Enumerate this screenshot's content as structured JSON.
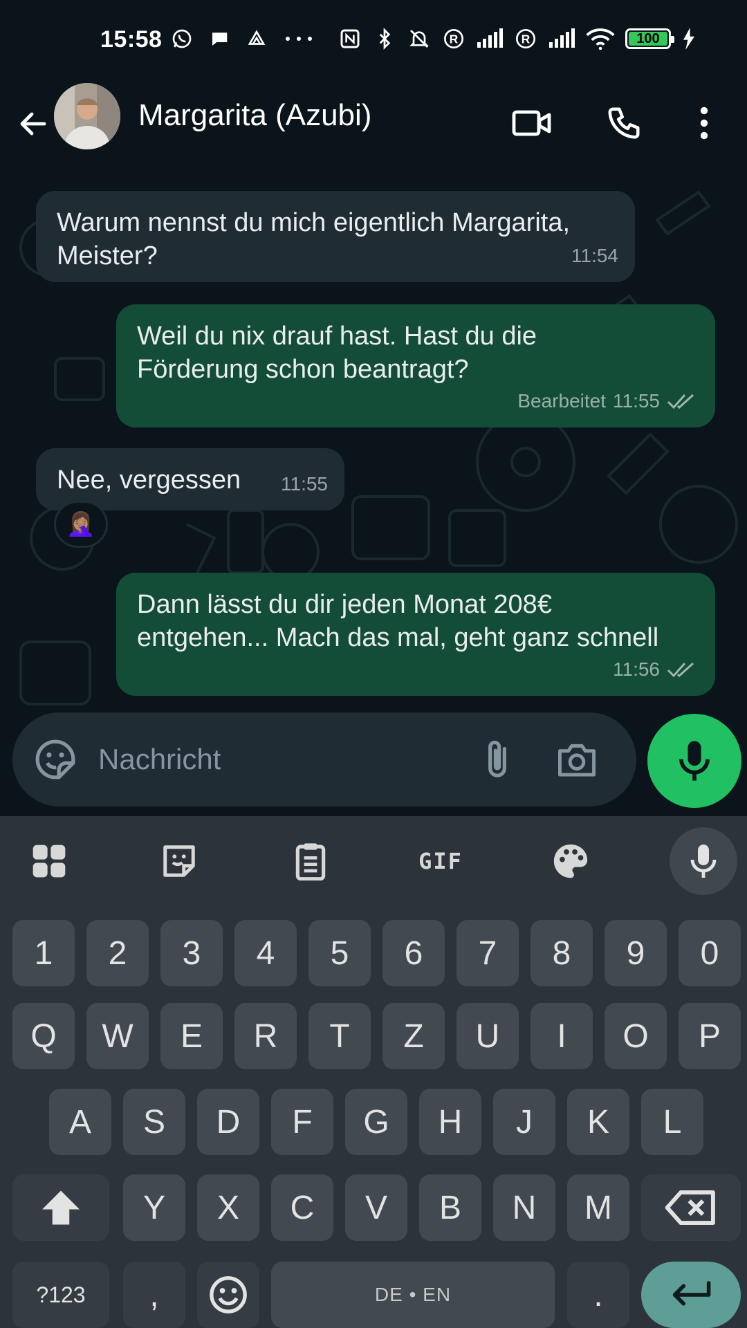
{
  "status_bar": {
    "time": "15:58",
    "battery_level": "100",
    "icons_left": [
      "whatsapp-icon",
      "chat-bubble-icon",
      "drive-icon",
      "more-dots-icon"
    ],
    "icons_right": [
      "nfc-icon",
      "bluetooth-icon",
      "bell-off-icon",
      "registered-icon",
      "signal-icon",
      "registered-icon",
      "signal-icon",
      "wifi-icon",
      "battery-icon",
      "charging-bolt-icon"
    ]
  },
  "header": {
    "contact_name": "Margarita (Azubi)",
    "icons": [
      "back-arrow-icon",
      "video-call-icon",
      "phone-call-icon",
      "more-vert-icon"
    ]
  },
  "messages": [
    {
      "direction": "incoming",
      "text": "Warum nennst du mich eigentlich Margarita,\nMeister?",
      "time": "11:54"
    },
    {
      "direction": "outgoing",
      "text": "Weil du nix drauf hast. Hast du die\nFörderung schon beantragt?",
      "edited_label": "Bearbeitet",
      "time": "11:55",
      "status": "read"
    },
    {
      "direction": "incoming",
      "text": "Nee, vergessen",
      "time": "11:55",
      "reaction": "🤦🏽‍♀️"
    },
    {
      "direction": "outgoing",
      "text": "Dann lässt du dir jeden Monat 208€\nentgehen...  Mach das mal, geht ganz schnell",
      "time": "11:56",
      "status": "read"
    }
  ],
  "composer": {
    "placeholder": "Nachricht"
  },
  "keyboard": {
    "toolbar": [
      "apps-grid-icon",
      "sticker-icon",
      "clipboard-icon",
      "GIF",
      "palette-icon",
      "mic-icon"
    ],
    "gif_label": "GIF",
    "row_numbers": [
      "1",
      "2",
      "3",
      "4",
      "5",
      "6",
      "7",
      "8",
      "9",
      "0"
    ],
    "row_1": [
      "Q",
      "W",
      "E",
      "R",
      "T",
      "Z",
      "U",
      "I",
      "O",
      "P"
    ],
    "row_2": [
      "A",
      "S",
      "D",
      "F",
      "G",
      "H",
      "J",
      "K",
      "L"
    ],
    "row_3": [
      "Y",
      "X",
      "C",
      "V",
      "B",
      "N",
      "M"
    ],
    "symbols_label": "?123",
    "comma_label": ",",
    "space_label": "DE • EN",
    "period_label": "."
  },
  "colors": {
    "background": "#0b141a",
    "incoming_bubble": "#202c33",
    "outgoing_bubble": "#144d37",
    "accent_green": "#21c063",
    "keyboard_bg": "#2c333a",
    "key_bg": "#424950",
    "enter_key": "#5e9e97"
  }
}
